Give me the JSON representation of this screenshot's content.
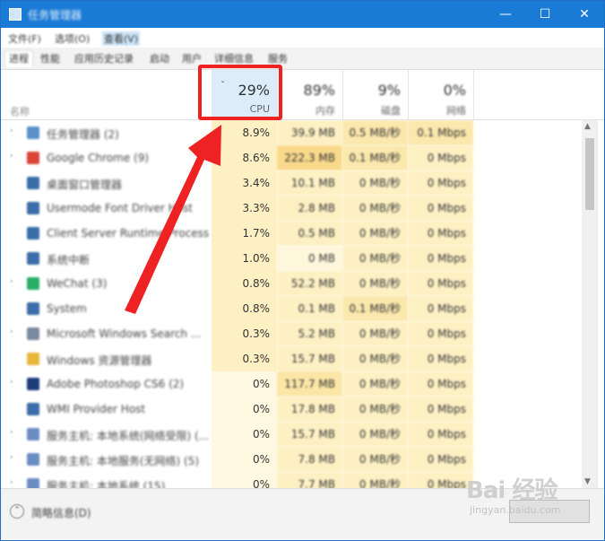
{
  "window": {
    "title": "任务管理器",
    "controls": {
      "minimize": "—",
      "maximize": "☐",
      "close": "✕"
    }
  },
  "menu": [
    "文件(F)",
    "选项(O)",
    "查看(V)"
  ],
  "tabs": [
    "进程",
    "性能",
    "应用历史记录",
    "启动",
    "用户",
    "详细信息",
    "服务"
  ],
  "columns": {
    "name": "名称",
    "cpu": {
      "percent": "29%",
      "label": "CPU",
      "sorted": true,
      "sort_indicator": "ˇ"
    },
    "memory": {
      "percent": "89%",
      "label": "内存"
    },
    "disk": {
      "percent": "9%",
      "label": "磁盘"
    },
    "network": {
      "percent": "0%",
      "label": "网络"
    }
  },
  "processes": [
    {
      "expand": "›",
      "name": "任务管理器 (2)",
      "icon_color": "#5a8fc8",
      "cpu": "8.9%",
      "memory": "39.9 MB",
      "disk": "0.5 MB/秒",
      "network": "0.1 Mbps"
    },
    {
      "expand": "›",
      "name": "Google Chrome (9)",
      "icon_color": "#db4437",
      "cpu": "8.6%",
      "memory": "222.3 MB",
      "disk": "0.1 MB/秒",
      "network": "0 Mbps"
    },
    {
      "expand": "",
      "name": "桌面窗口管理器",
      "icon_color": "#3a6ea8",
      "cpu": "3.4%",
      "memory": "10.1 MB",
      "disk": "0 MB/秒",
      "network": "0 Mbps"
    },
    {
      "expand": "",
      "name": "Usermode Font Driver Host",
      "icon_color": "#3a6ea8",
      "cpu": "3.3%",
      "memory": "2.8 MB",
      "disk": "0 MB/秒",
      "network": "0 Mbps"
    },
    {
      "expand": "",
      "name": "Client Server Runtime Process",
      "icon_color": "#3a6ea8",
      "cpu": "1.7%",
      "memory": "0.5 MB",
      "disk": "0 MB/秒",
      "network": "0 Mbps"
    },
    {
      "expand": "",
      "name": "系统中断",
      "icon_color": "#3a6ea8",
      "cpu": "1.0%",
      "memory": "0 MB",
      "disk": "0 MB/秒",
      "network": "0 Mbps"
    },
    {
      "expand": "›",
      "name": "WeChat (3)",
      "icon_color": "#2aae67",
      "cpu": "0.8%",
      "memory": "52.2 MB",
      "disk": "0 MB/秒",
      "network": "0 Mbps"
    },
    {
      "expand": "",
      "name": "System",
      "icon_color": "#3a6ea8",
      "cpu": "0.8%",
      "memory": "0.1 MB",
      "disk": "0.1 MB/秒",
      "network": "0 Mbps"
    },
    {
      "expand": "›",
      "name": "Microsoft Windows Search ...",
      "icon_color": "#7a8aa0",
      "cpu": "0.3%",
      "memory": "5.2 MB",
      "disk": "0 MB/秒",
      "network": "0 Mbps"
    },
    {
      "expand": "",
      "name": "Windows 资源管理器",
      "icon_color": "#e8b73a",
      "cpu": "0.3%",
      "memory": "15.7 MB",
      "disk": "0 MB/秒",
      "network": "0 Mbps"
    },
    {
      "expand": "›",
      "name": "Adobe Photoshop CS6 (2)",
      "icon_color": "#1c3c7a",
      "cpu": "0%",
      "memory": "117.7 MB",
      "disk": "0 MB/秒",
      "network": "0 Mbps"
    },
    {
      "expand": "",
      "name": "WMI Provider Host",
      "icon_color": "#3a6ea8",
      "cpu": "0%",
      "memory": "17.8 MB",
      "disk": "0 MB/秒",
      "network": "0 Mbps"
    },
    {
      "expand": "›",
      "name": "服务主机: 本地系统(网络受限) (...",
      "icon_color": "#6a8cc0",
      "cpu": "0%",
      "memory": "15.7 MB",
      "disk": "0 MB/秒",
      "network": "0 Mbps"
    },
    {
      "expand": "›",
      "name": "服务主机: 本地服务(无网络) (5)",
      "icon_color": "#6a8cc0",
      "cpu": "0%",
      "memory": "7.8 MB",
      "disk": "0 MB/秒",
      "network": "0 Mbps"
    },
    {
      "expand": "›",
      "name": "服务主机: 本地系统 (15)",
      "icon_color": "#6a8cc0",
      "cpu": "0%",
      "memory": "7.7 MB",
      "disk": "0 MB/秒",
      "network": "0 Mbps"
    }
  ],
  "footer": {
    "fewer_details": "简略信息(D)",
    "collapse_icon": "⌃",
    "end_task": ""
  },
  "watermark": {
    "main": "Bai 经验",
    "sub": "jingyan.baidu.com"
  },
  "annotation": {
    "highlight_color": "#ee2222",
    "target": "CPU column header"
  }
}
